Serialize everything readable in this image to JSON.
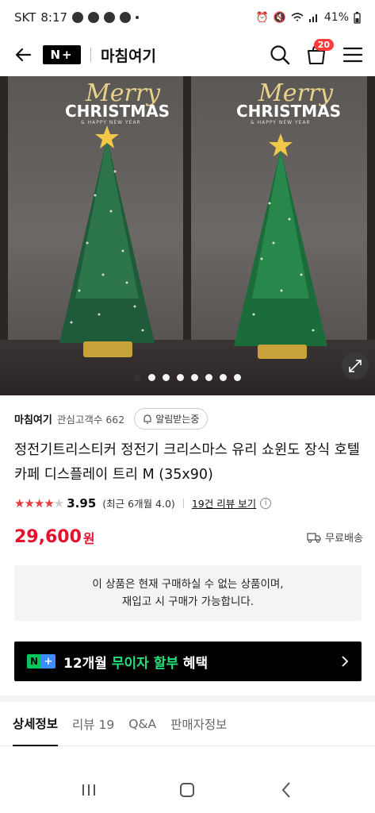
{
  "status_bar": {
    "carrier": "SKT",
    "time": "8:17",
    "talk_icon_label": "TALK",
    "battery": "41%"
  },
  "header": {
    "brand_badge": "N+",
    "store_title": "마침여기",
    "cart_count": "20"
  },
  "hero": {
    "left_merry": "Merry",
    "left_christmas": "CHRISTMAS",
    "left_happy": "& HAPPY NEW YEAR",
    "right_merry": "Merry",
    "right_christmas": "CHRISTMAS",
    "right_happy": "& HAPPY NEW YEAR",
    "slide_count": 8,
    "active_slide": 1
  },
  "store": {
    "name": "마침여기",
    "followers_label": "관심고객수 662",
    "notify_button": "알림받는중"
  },
  "product": {
    "title": "정전기트리스티커 정전기 크리스마스 유리 쇼윈도 장식 호텔 카페 디스플레이 트리 M (35x90)",
    "rating_value": "3.95",
    "rating_stars": 4,
    "rating_sub": "(최근 6개월 4.0)",
    "review_link": "19건 리뷰 보기",
    "price": "29,600",
    "currency": "원",
    "shipping": "무료배송"
  },
  "soldout": {
    "line1": "이 상품은 현재 구매하실 수 없는 상품이며,",
    "line2": "재입고 시 구매가 가능합니다."
  },
  "banner": {
    "logo_n": "N",
    "logo_plus": "+",
    "text_prefix": "12개월 ",
    "text_highlight": "무이자 할부",
    "text_suffix": " 혜택"
  },
  "tabs": [
    {
      "label": "상세정보",
      "active": true
    },
    {
      "label": "리뷰 19",
      "active": false
    },
    {
      "label": "Q&A",
      "active": false
    },
    {
      "label": "판매자정보",
      "active": false
    }
  ],
  "colors": {
    "price_red": "#e8112d",
    "star_red": "#e43d3d",
    "naver_green": "#03c75a",
    "highlight_green": "#25e07c",
    "badge_red": "#ff3b3b"
  }
}
